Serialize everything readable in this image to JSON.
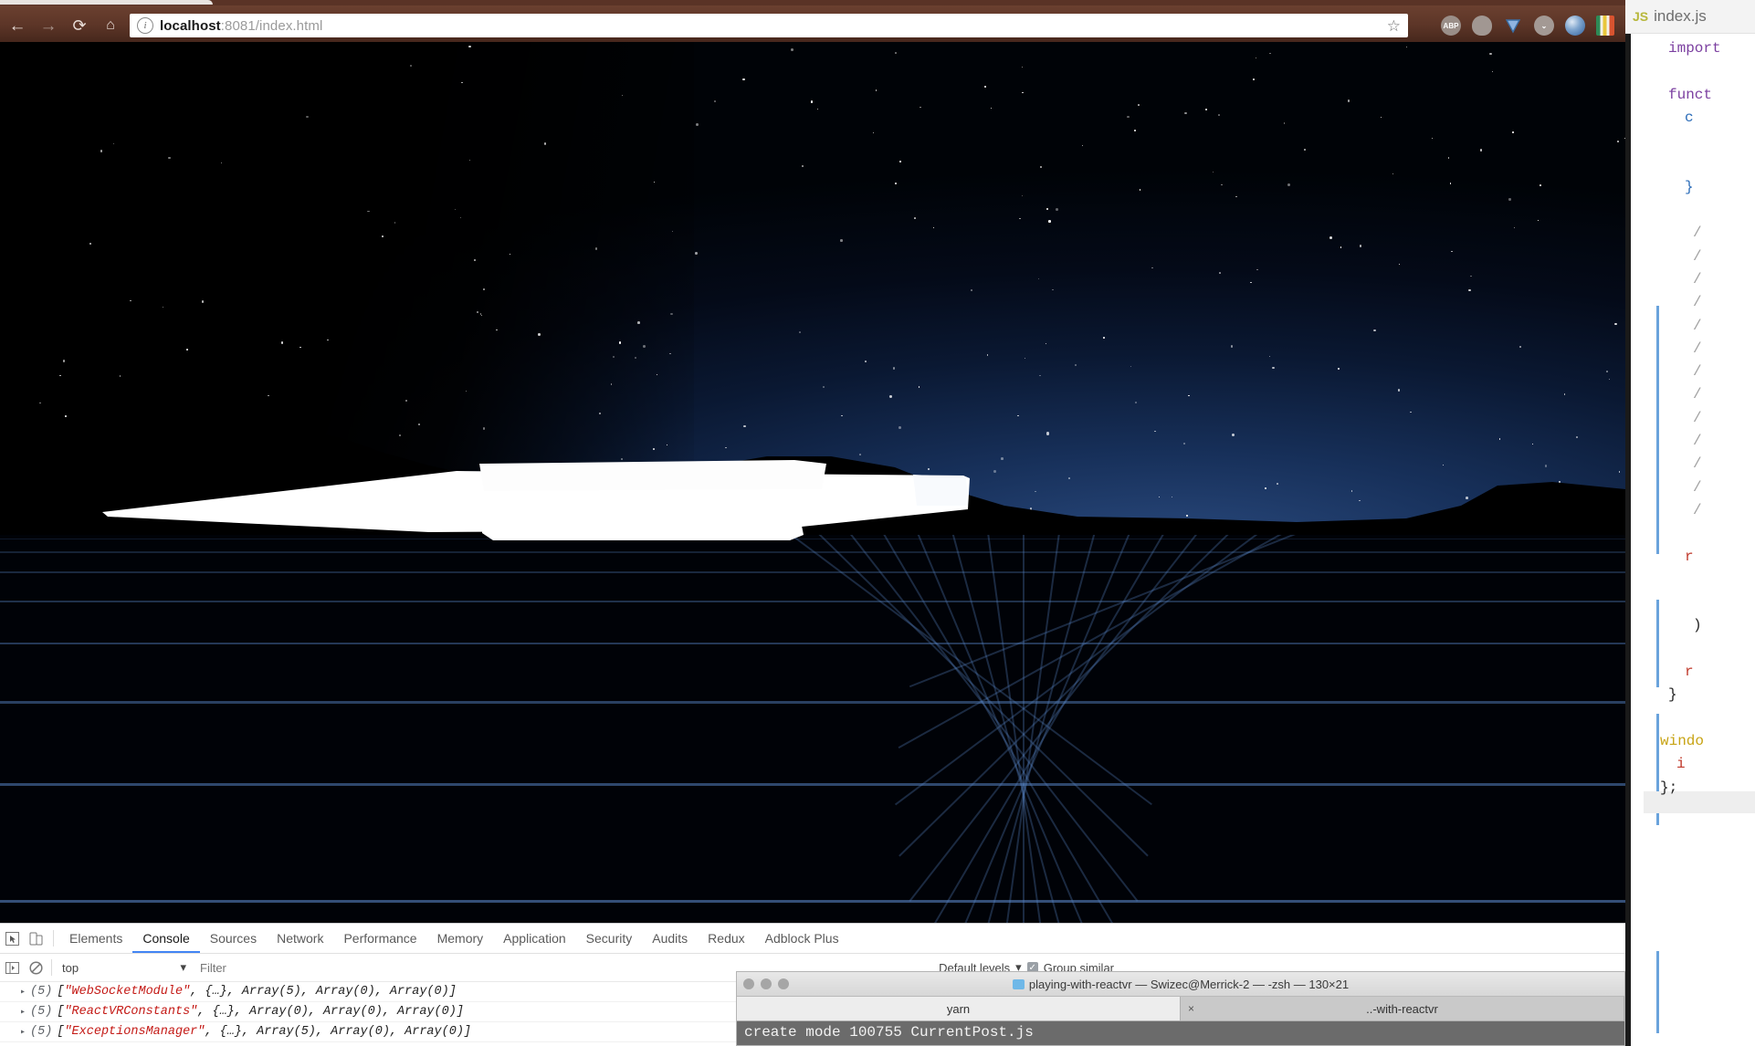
{
  "browser": {
    "nav": {
      "back_icon": "arrow-left-icon",
      "forward_icon": "arrow-right-icon",
      "reload_icon": "reload-icon",
      "home_icon": "home-icon",
      "back_glyph": "←",
      "forward_glyph": "→",
      "reload_glyph": "⟳",
      "home_glyph": "⌂"
    },
    "omnibox": {
      "info_glyph": "i",
      "url_host": "localhost",
      "url_rest": ":8081/index.html",
      "star_glyph": "☆"
    },
    "extensions": [
      {
        "name": "adblock-plus-extension-icon",
        "label": "ABP"
      },
      {
        "name": "ghostery-extension-icon",
        "label": ""
      },
      {
        "name": "vimium-extension-icon",
        "label": ""
      },
      {
        "name": "pocket-extension-icon",
        "label": "⌄"
      },
      {
        "name": "globe-extension-icon",
        "label": ""
      },
      {
        "name": "colorzilla-extension-icon",
        "label": ""
      }
    ]
  },
  "viewport": {
    "scene_name": "react-vr-night-scene",
    "description": "360 starfield night sky with hill silhouettes, blue perspective grid floor and a white flat panel"
  },
  "devtools": {
    "tools": [
      {
        "name": "inspect-element-icon",
        "glyph": "⬚"
      },
      {
        "name": "device-toolbar-icon",
        "glyph": "▭"
      }
    ],
    "tabs": [
      {
        "label": "Elements",
        "active": false
      },
      {
        "label": "Console",
        "active": true
      },
      {
        "label": "Sources",
        "active": false
      },
      {
        "label": "Network",
        "active": false
      },
      {
        "label": "Performance",
        "active": false
      },
      {
        "label": "Memory",
        "active": false
      },
      {
        "label": "Application",
        "active": false
      },
      {
        "label": "Security",
        "active": false
      },
      {
        "label": "Audits",
        "active": false
      },
      {
        "label": "Redux",
        "active": false
      },
      {
        "label": "Adblock Plus",
        "active": false
      }
    ],
    "filterbar": {
      "sidebar_toggle_icon": "▶",
      "clear_console_icon": "⊘",
      "context": "top",
      "context_caret": "▾",
      "filter_placeholder": "Filter",
      "levels_label": "Default levels",
      "levels_caret": "▾",
      "group_similar_label": "Group similar",
      "group_similar_checked": true,
      "check_glyph": "✓"
    },
    "console_rows": [
      {
        "arrow": "▸",
        "count": "(5)",
        "open": "[",
        "module": "\"WebSocketModule\"",
        "rest": ", {…}, Array(5), Array(0), Array(0)]"
      },
      {
        "arrow": "▸",
        "count": "(5)",
        "open": "[",
        "module": "\"ReactVRConstants\"",
        "rest": ", {…}, Array(0), Array(0), Array(0)]"
      },
      {
        "arrow": "▸",
        "count": "(5)",
        "open": "[",
        "module": "\"ExceptionsManager\"",
        "rest": ", {…}, Array(5), Array(0), Array(0)]"
      }
    ]
  },
  "editor": {
    "badge": "JS",
    "tab_name": "index.js",
    "lines": [
      {
        "text": "import",
        "cls": "k"
      },
      {
        "text": "",
        "cls": "pl"
      },
      {
        "text": "funct",
        "cls": "k"
      },
      {
        "text": "c",
        "cls": "fn"
      },
      {
        "text": "",
        "cls": "pl"
      },
      {
        "text": "",
        "cls": "pl"
      },
      {
        "text": "}",
        "cls": "fn"
      },
      {
        "text": "",
        "cls": "pl"
      },
      {
        "text": "/",
        "cls": "cm"
      },
      {
        "text": "/",
        "cls": "cm"
      },
      {
        "text": "/",
        "cls": "cm"
      },
      {
        "text": "/",
        "cls": "cm"
      },
      {
        "text": "/",
        "cls": "cm"
      },
      {
        "text": "/",
        "cls": "cm"
      },
      {
        "text": "/",
        "cls": "cm"
      },
      {
        "text": "/",
        "cls": "cm"
      },
      {
        "text": "/",
        "cls": "cm"
      },
      {
        "text": "/",
        "cls": "cm"
      },
      {
        "text": "/",
        "cls": "cm"
      },
      {
        "text": "/",
        "cls": "cm"
      },
      {
        "text": "/",
        "cls": "cm"
      },
      {
        "text": "",
        "cls": "pl"
      },
      {
        "text": "r",
        "cls": "ret"
      },
      {
        "text": "",
        "cls": "pl"
      },
      {
        "text": "",
        "cls": "pl"
      },
      {
        "text": ")",
        "cls": "pl"
      },
      {
        "text": "",
        "cls": "pl"
      },
      {
        "text": "r",
        "cls": "ret"
      },
      {
        "text": "}",
        "cls": "pl"
      },
      {
        "text": "",
        "cls": "pl"
      },
      {
        "text": "windo",
        "cls": "win"
      },
      {
        "text": "i",
        "cls": "ret"
      },
      {
        "text": "};",
        "cls": "pl"
      }
    ]
  },
  "terminal": {
    "title": "playing-with-reactvr — Swizec@Merrick-2 — -zsh — 130×21",
    "tabs": [
      {
        "label": "yarn",
        "active": true,
        "close": ""
      },
      {
        "label": "..-with-reactvr",
        "active": false,
        "close": "×"
      }
    ],
    "output": "create mode 100755 CurrentPost.js"
  },
  "colors": {
    "chrome_brown": "#5c3527",
    "devtools_accent": "#4285f4",
    "console_string": "#c41a16",
    "grid_blue": "#5684c4",
    "sky_blue": "#2a4a7e"
  }
}
